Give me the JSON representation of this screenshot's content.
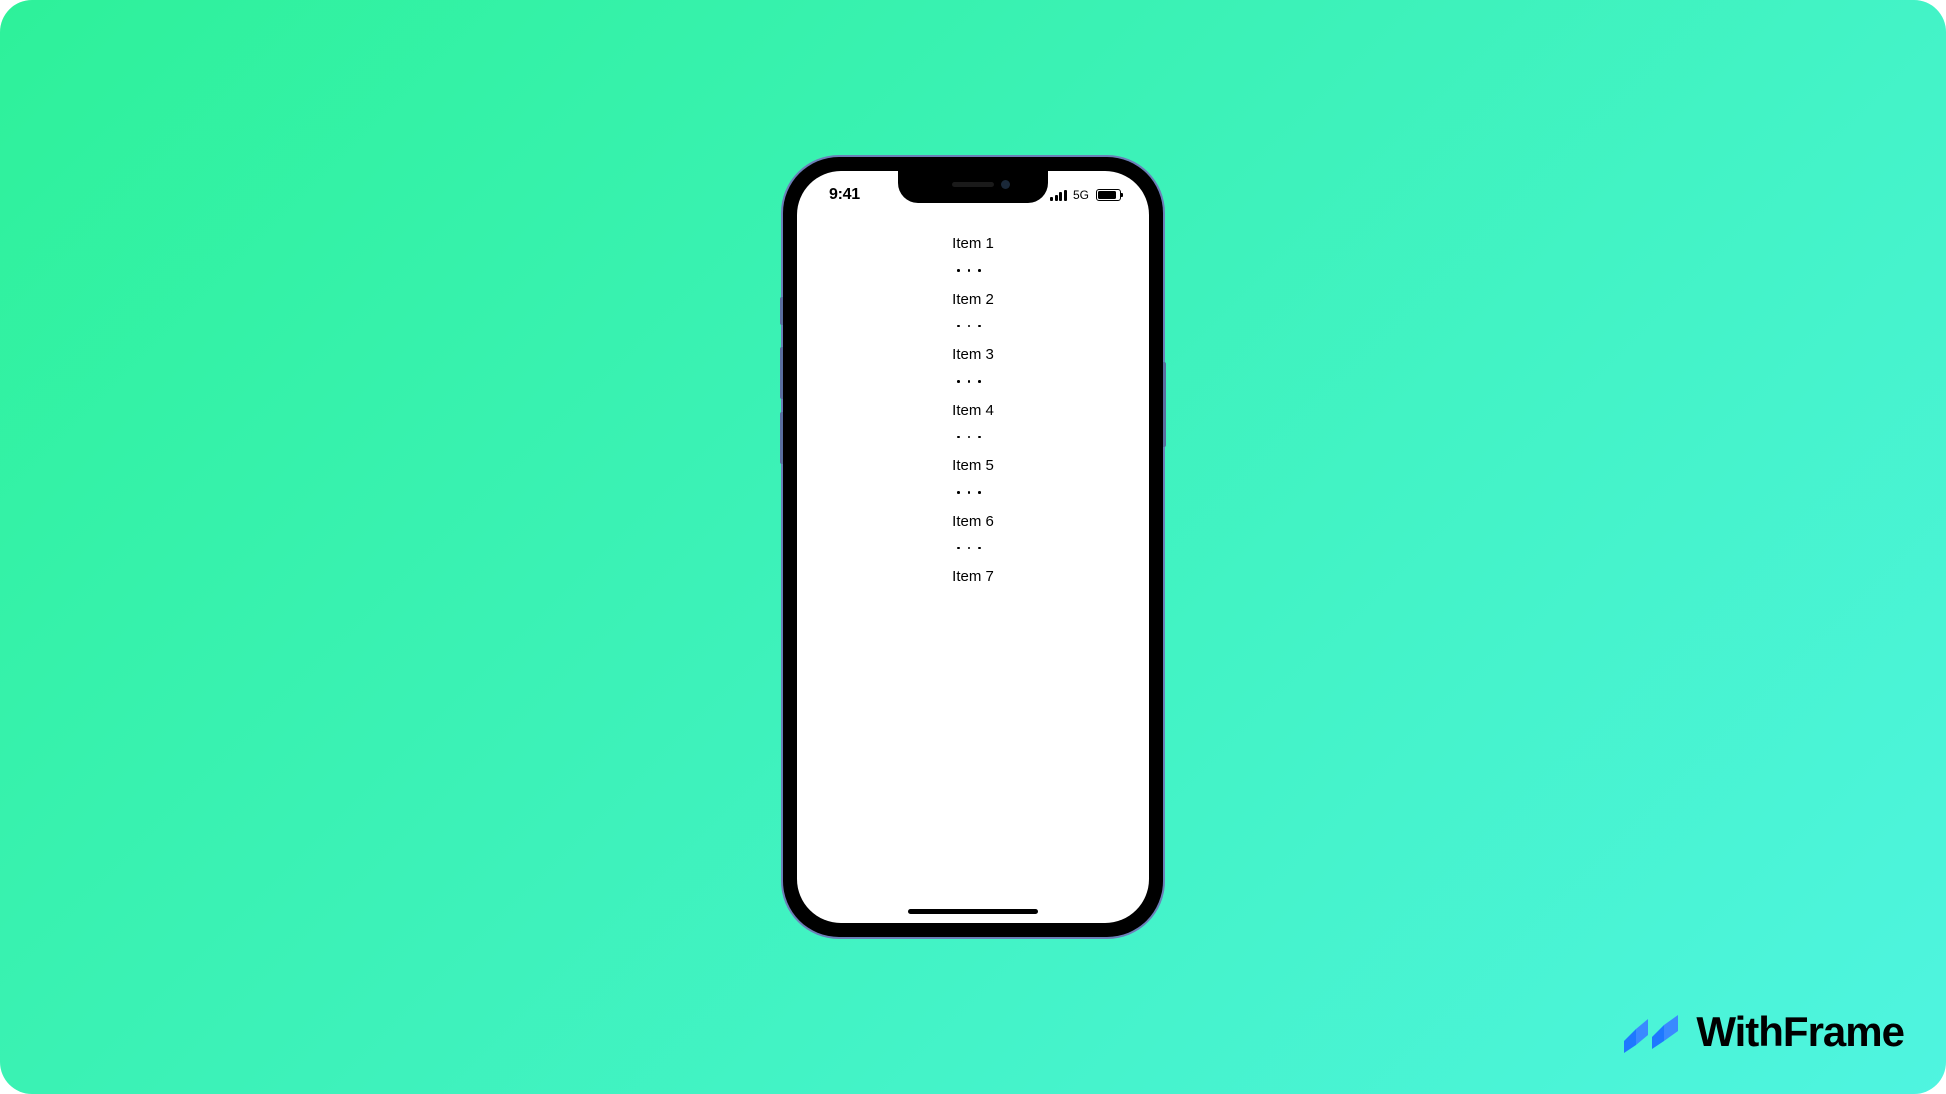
{
  "status_bar": {
    "time": "9:41",
    "network": "5G"
  },
  "list": {
    "items": [
      {
        "label": "Item 1"
      },
      {
        "label": "Item 2"
      },
      {
        "label": "Item 3"
      },
      {
        "label": "Item 4"
      },
      {
        "label": "Item 5"
      },
      {
        "label": "Item 6"
      },
      {
        "label": "Item 7"
      }
    ]
  },
  "brand": {
    "name": "WithFrame"
  }
}
